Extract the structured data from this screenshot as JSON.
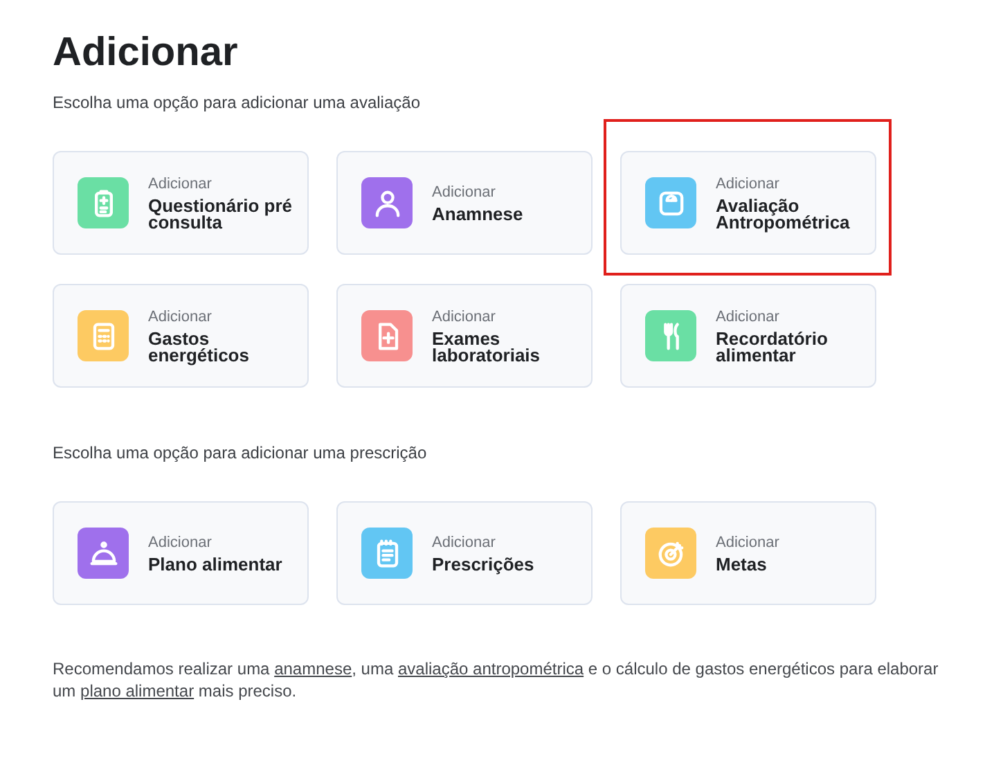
{
  "title": "Adicionar",
  "sections": [
    {
      "label": "Escolha uma opção para adicionar uma avaliação",
      "cards": [
        {
          "caption": "Adicionar",
          "name": "Questionário pré consulta",
          "color": "#6adfa4",
          "highlighted": false
        },
        {
          "caption": "Adicionar",
          "name": "Anamnese",
          "color": "#9f70ec",
          "highlighted": false
        },
        {
          "caption": "Adicionar",
          "name": "Avaliação Antropométrica",
          "color": "#62c6f3",
          "highlighted": true
        },
        {
          "caption": "Adicionar",
          "name": "Gastos energéticos",
          "color": "#fdca62",
          "highlighted": false
        },
        {
          "caption": "Adicionar",
          "name": "Exames laboratoriais",
          "color": "#f7908f",
          "highlighted": false
        },
        {
          "caption": "Adicionar",
          "name": "Recordatório alimentar",
          "color": "#6adfa4",
          "highlighted": false
        }
      ]
    },
    {
      "label": "Escolha uma opção para adicionar uma prescrição",
      "cards": [
        {
          "caption": "Adicionar",
          "name": "Plano alimentar",
          "color": "#9f70ec",
          "highlighted": false
        },
        {
          "caption": "Adicionar",
          "name": "Prescrições",
          "color": "#62c6f3",
          "highlighted": false
        },
        {
          "caption": "Adicionar",
          "name": "Metas",
          "color": "#fdca62",
          "highlighted": false
        }
      ]
    }
  ],
  "footer": [
    {
      "kind": "text",
      "text": "Recomendamos realizar uma "
    },
    {
      "kind": "link",
      "text": "anamnese"
    },
    {
      "kind": "text",
      "text": ", uma "
    },
    {
      "kind": "link",
      "text": "avaliação antropométrica"
    },
    {
      "kind": "text",
      "text": " e o cálculo de gastos energéticos para elaborar um "
    },
    {
      "kind": "link",
      "text": "plano alimentar"
    },
    {
      "kind": "text",
      "text": " mais preciso."
    }
  ]
}
